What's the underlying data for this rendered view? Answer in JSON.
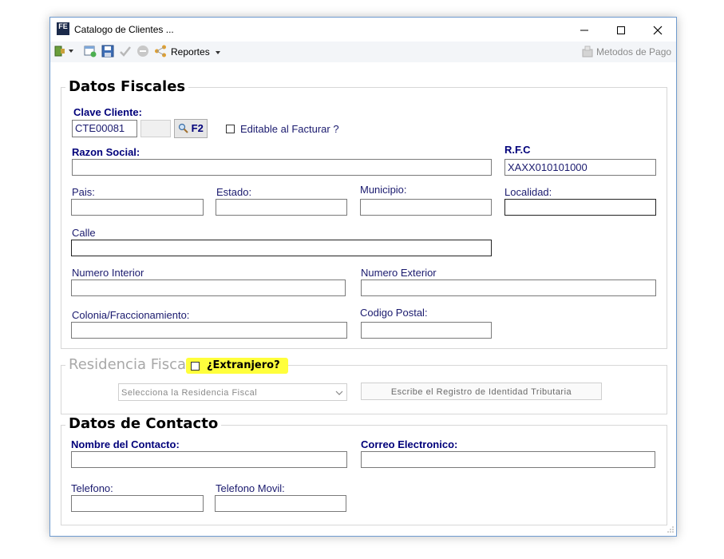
{
  "window": {
    "title": "Catalogo de Clientes ...",
    "app_icon_text": "FE"
  },
  "toolbar": {
    "reportes_label": "Reportes",
    "metodos_label": "Metodos de Pago"
  },
  "datos_fiscales": {
    "legend": "Datos Fiscales",
    "clave_label": "Clave Cliente:",
    "clave_value": "CTE00081",
    "f2_label": "F2",
    "editable_label": "Editable al Facturar ?",
    "razon_label": "Razon Social:",
    "rfc_label": "R.F.C",
    "rfc_value": "XAXX010101000",
    "pais_label": "Pais:",
    "estado_label": "Estado:",
    "municipio_label": "Municipio:",
    "localidad_label": "Localidad:",
    "calle_label": "Calle",
    "num_int_label": "Numero Interior",
    "num_ext_label": "Numero Exterior",
    "colonia_label": "Colonia/Fraccionamiento:",
    "cp_label": "Codigo Postal:"
  },
  "residencia": {
    "legend": "Residencia Fiscal",
    "extranjero_label": "¿Extranjero?",
    "select_placeholder": "Selecciona la Residencia Fiscal",
    "registro_placeholder": "Escribe el Registro de Identidad Tributaria"
  },
  "contacto": {
    "legend": "Datos de Contacto",
    "nombre_label": "Nombre del Contacto:",
    "correo_label": "Correo Electronico:",
    "telefono_label": "Telefono:",
    "movil_label": "Telefono Movil:"
  },
  "colors": {
    "label_blue": "#1a1a6e",
    "highlight": "#ffff3c",
    "border_blue": "#6f9bcf"
  },
  "icons": [
    "exit-icon",
    "new-record-icon",
    "save-icon",
    "check-icon",
    "cancel-icon",
    "share-icon",
    "search-icon",
    "payment-icon"
  ]
}
